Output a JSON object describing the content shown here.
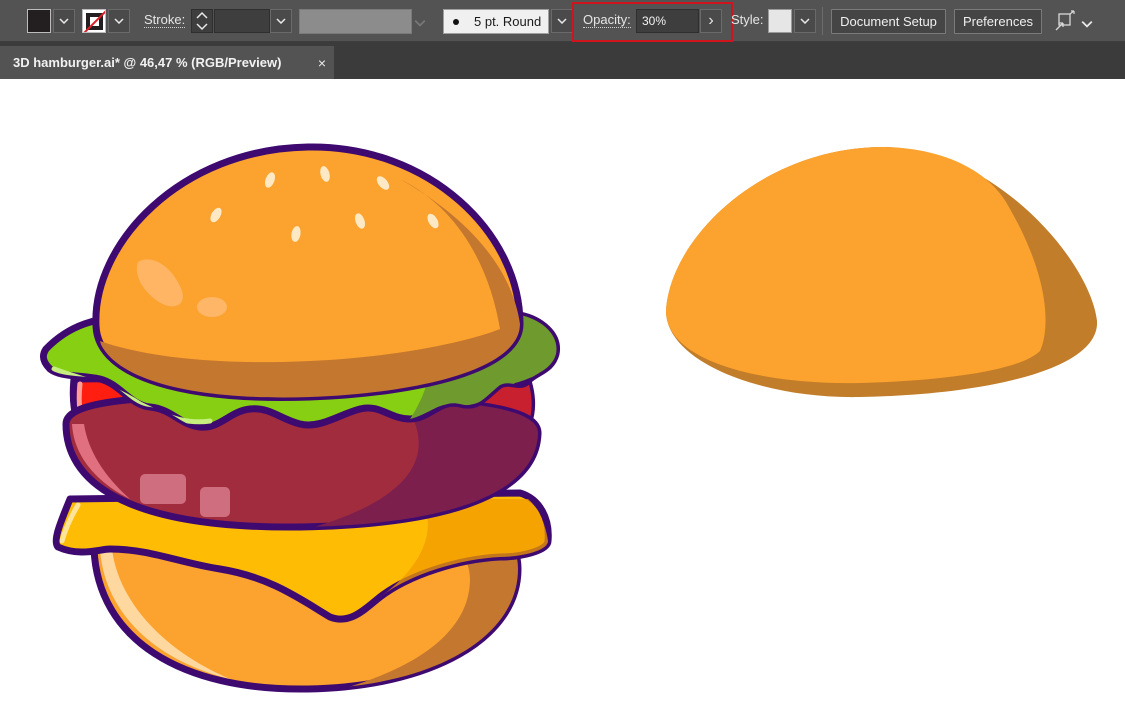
{
  "control_bar": {
    "fill_swatch": {
      "icon": "fill-swatch-icon",
      "color": "#231f20"
    },
    "stroke_swatch": {
      "icon": "stroke-none-swatch-icon"
    },
    "stroke_label": "Stroke:",
    "brush_label": "5 pt. Round",
    "opacity_label": "Opacity:",
    "opacity_value": "30%",
    "opacity_arrow": "›",
    "style_label": "Style:",
    "document_setup_label": "Document Setup",
    "preferences_label": "Preferences",
    "arrange_icon": "arrange-docs-icon",
    "highlight_color": "#d0141e"
  },
  "tabs": [
    {
      "label": "3D hamburger.ai* @ 46,47 % (RGB/Preview)",
      "close": "×"
    }
  ],
  "colors": {
    "outline": "#3f0a70",
    "bun_orange": "#fca22e",
    "bun_shadow": "#c4772f",
    "bun2_shadow": "#c27d2a",
    "lettuce": "#86cf12",
    "lettuce_shadow": "#6e9a2e",
    "tomato": "#ff1e0f",
    "tomato_shadow": "#c8202e",
    "patty": "#a12c3e",
    "patty_shadow": "#7d1f4c",
    "cheese": "#ffbc05",
    "highlight_light": "#ffd8a0"
  }
}
